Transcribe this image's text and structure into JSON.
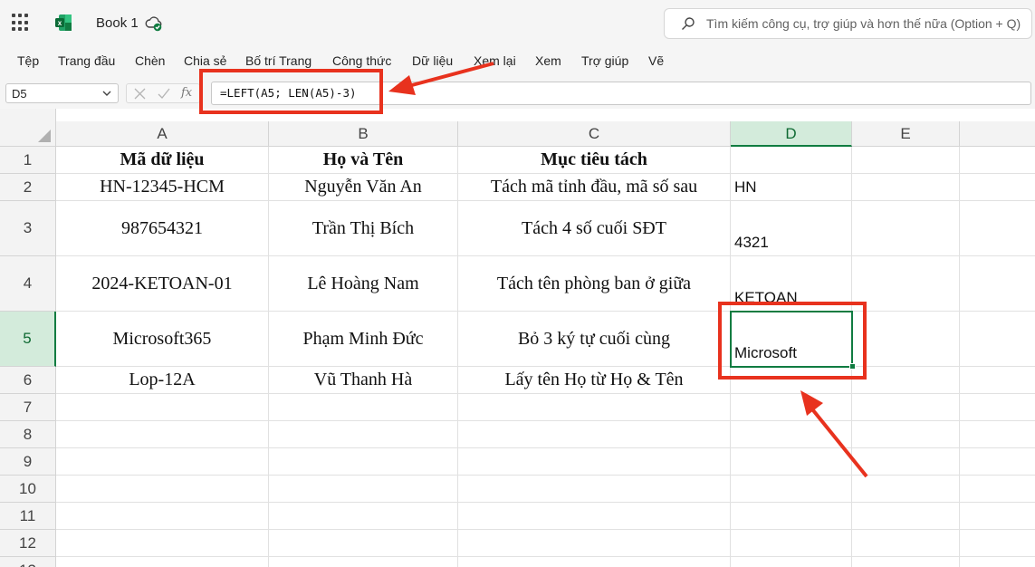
{
  "app": {
    "title": "Book 1"
  },
  "search": {
    "placeholder": "Tìm kiếm công cụ, trợ giúp và hơn thế nữa (Option + Q)"
  },
  "ribbon": {
    "tabs": [
      "Tệp",
      "Trang đầu",
      "Chèn",
      "Chia sẻ",
      "Bố trí Trang",
      "Công thức",
      "Dữ liệu",
      "Xem lại",
      "Xem",
      "Trợ giúp",
      "Vẽ"
    ]
  },
  "formula_bar": {
    "name_box": "D5",
    "fx_label": "fx",
    "formula": "=LEFT(A5; LEN(A5)-3)"
  },
  "grid": {
    "columns": [
      "A",
      "B",
      "C",
      "D",
      "E"
    ],
    "selected_column": "D",
    "selected_row": "5",
    "selected_cell": "D5",
    "rows": [
      {
        "num": "1",
        "cells": [
          "Mã dữ liệu",
          "Họ và Tên",
          "Mục tiêu tách",
          "",
          ""
        ]
      },
      {
        "num": "2",
        "cells": [
          "HN-12345-HCM",
          "Nguyễn Văn An",
          "Tách mã tỉnh đầu, mã số sau",
          "HN",
          ""
        ]
      },
      {
        "num": "3",
        "cells": [
          "987654321",
          "Trần Thị Bích",
          "Tách 4 số cuối SĐT",
          "4321",
          ""
        ]
      },
      {
        "num": "4",
        "cells": [
          "2024-KETOAN-01",
          "Lê Hoàng Nam",
          "Tách tên phòng ban ở giữa",
          "KETOAN",
          ""
        ]
      },
      {
        "num": "5",
        "cells": [
          "Microsoft365",
          "Phạm Minh Đức",
          "Bỏ 3 ký tự cuối cùng",
          "Microsoft",
          ""
        ]
      },
      {
        "num": "6",
        "cells": [
          "Lop-12A",
          "Vũ Thanh Hà",
          "Lấy tên Họ từ Họ & Tên",
          "",
          ""
        ]
      },
      {
        "num": "7",
        "cells": [
          "",
          "",
          "",
          "",
          ""
        ]
      },
      {
        "num": "8",
        "cells": [
          "",
          "",
          "",
          "",
          ""
        ]
      },
      {
        "num": "9",
        "cells": [
          "",
          "",
          "",
          "",
          ""
        ]
      },
      {
        "num": "10",
        "cells": [
          "",
          "",
          "",
          "",
          ""
        ]
      },
      {
        "num": "11",
        "cells": [
          "",
          "",
          "",
          "",
          ""
        ]
      },
      {
        "num": "12",
        "cells": [
          "",
          "",
          "",
          "",
          ""
        ]
      },
      {
        "num": "13",
        "cells": [
          "",
          "",
          "",
          "",
          ""
        ]
      }
    ]
  },
  "colors": {
    "accent": "#107c41",
    "annotation": "#e8321e",
    "selected_header": "#d3ebdb"
  },
  "icons": [
    "app-launcher-icon",
    "excel-logo-icon",
    "cloud-saved-icon",
    "search-icon",
    "chevron-down-icon",
    "cancel-icon",
    "enter-check-icon"
  ]
}
